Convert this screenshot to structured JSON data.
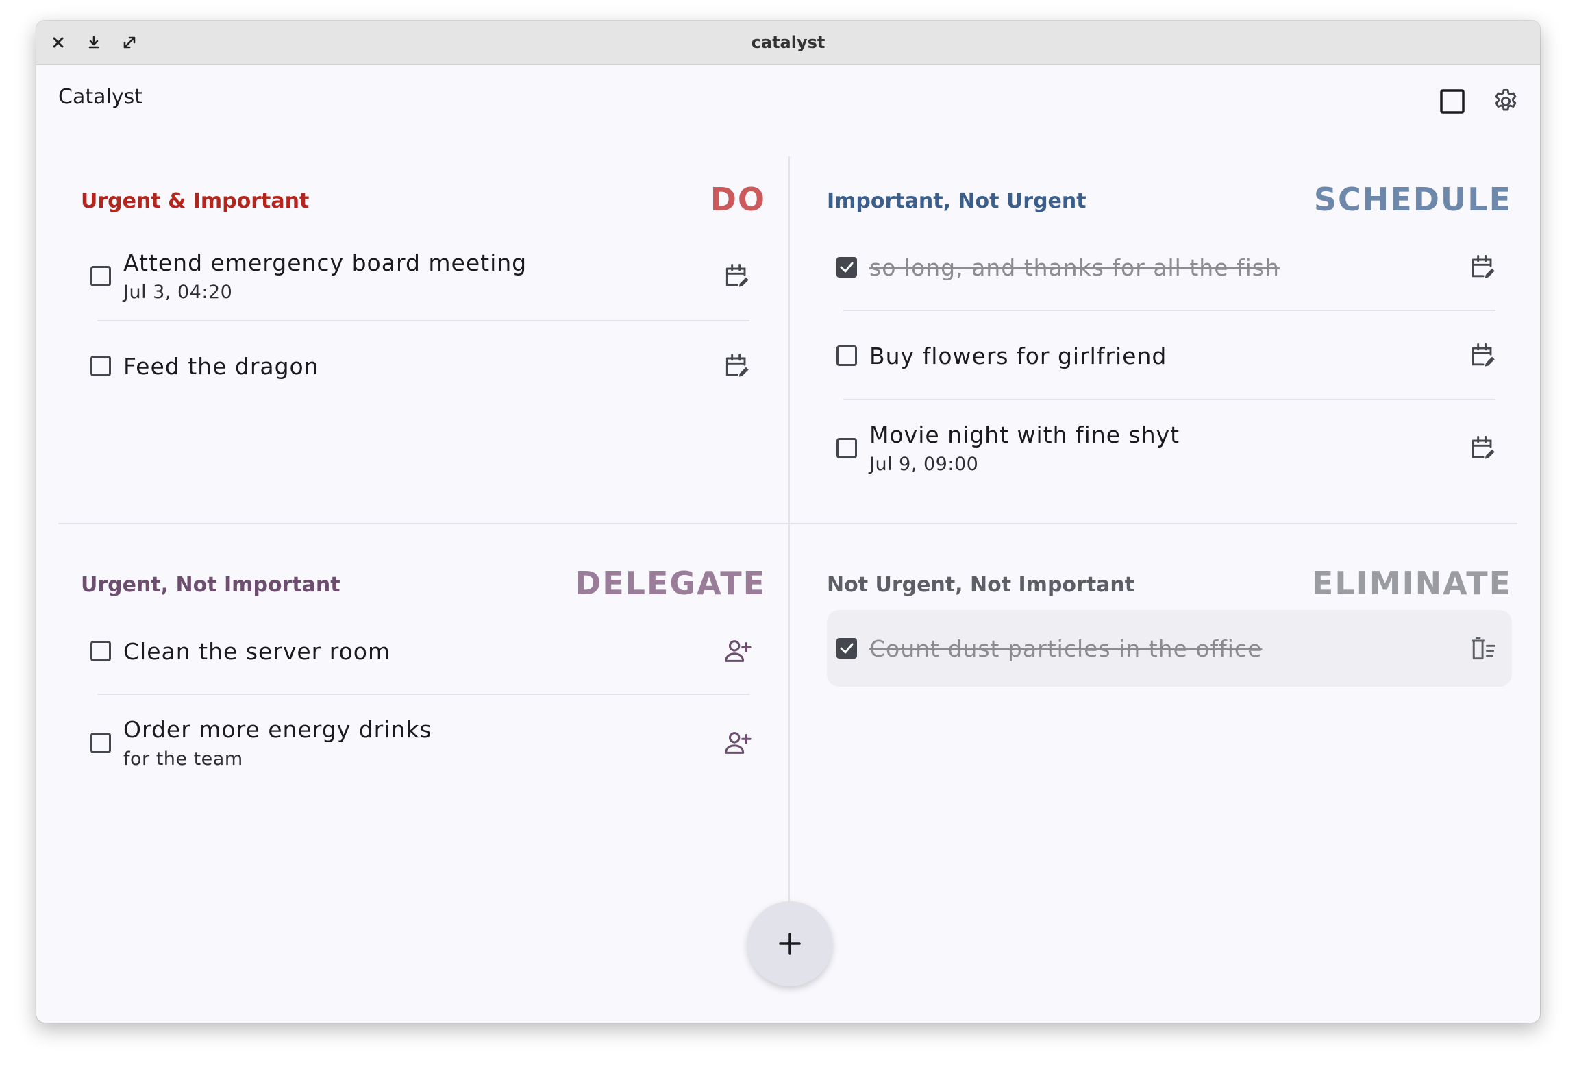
{
  "window": {
    "title": "catalyst"
  },
  "appbar": {
    "title": "Catalyst"
  },
  "colors": {
    "do": "#b3261e",
    "schedule": "#3b5f8a",
    "delegate": "#6e4e6f",
    "eliminate": "#5c5f66"
  },
  "quadrants": {
    "do": {
      "subtitle": "Urgent & Important",
      "label": "DO",
      "tasks": [
        {
          "title": "Attend emergency board meeting",
          "subtitle": "Jul 3, 04:20",
          "done": false,
          "action_icon": "calendar-edit-icon"
        },
        {
          "title": "Feed the dragon",
          "subtitle": "",
          "done": false,
          "action_icon": "calendar-edit-icon"
        }
      ]
    },
    "schedule": {
      "subtitle": "Important, Not Urgent",
      "label": "SCHEDULE",
      "tasks": [
        {
          "title": "so long, and thanks for all the fish",
          "subtitle": "",
          "done": true,
          "action_icon": "calendar-edit-icon"
        },
        {
          "title": "Buy flowers for girlfriend",
          "subtitle": "",
          "done": false,
          "action_icon": "calendar-edit-icon"
        },
        {
          "title": "Movie night with fine shyt",
          "subtitle": "Jul 9, 09:00",
          "done": false,
          "action_icon": "calendar-edit-icon"
        }
      ]
    },
    "delegate": {
      "subtitle": "Urgent, Not Important",
      "label": "DELEGATE",
      "tasks": [
        {
          "title": "Clean the server room",
          "subtitle": "",
          "done": false,
          "action_icon": "person-add-icon"
        },
        {
          "title": "Order more energy drinks",
          "subtitle": "for the team",
          "done": false,
          "action_icon": "person-add-icon"
        }
      ]
    },
    "eliminate": {
      "subtitle": "Not Urgent, Not Important",
      "label": "ELIMINATE",
      "tasks": [
        {
          "title": "Count dust particles in the office",
          "subtitle": "",
          "done": true,
          "action_icon": "delete-sweep-icon"
        }
      ]
    }
  },
  "fab": {
    "icon": "plus-icon"
  }
}
